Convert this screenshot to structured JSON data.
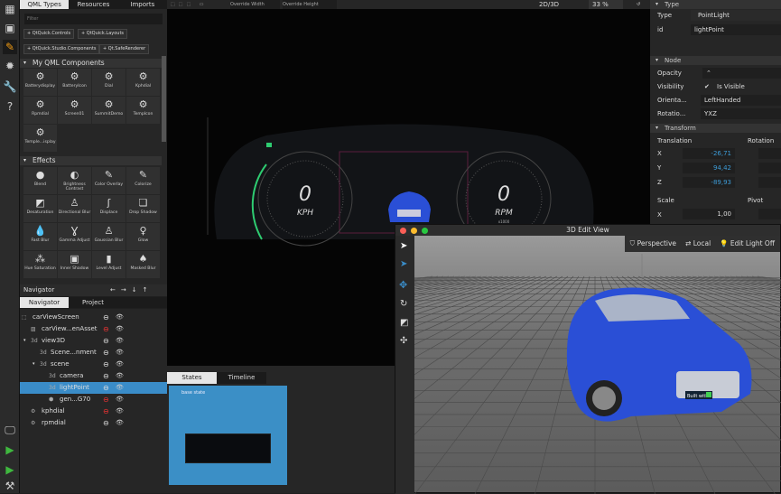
{
  "library": {
    "tabs": [
      "QML Types",
      "Resources",
      "Imports"
    ],
    "filter_placeholder": "Filter",
    "imports": [
      "QtQuick.Controls",
      "QtQuick.Layouts",
      "QtQuick.Studio.Components",
      "Qt.SafeRenderer"
    ],
    "my_components_title": "My QML Components",
    "components": [
      "Batterydisplay",
      "BatteryIcon",
      "Dial",
      "Kphdial",
      "Rpmdial",
      "Screen01",
      "SummitDemo",
      "TempIcon",
      "Temple...isplay"
    ],
    "effects_title": "Effects",
    "effects": [
      {
        "label": "Blend",
        "icon": "●"
      },
      {
        "label": "Brightness Contrast",
        "icon": "◐"
      },
      {
        "label": "Color Overlay",
        "icon": "✎"
      },
      {
        "label": "Colorize",
        "icon": "✎"
      },
      {
        "label": "Desaturation",
        "icon": "◩"
      },
      {
        "label": "Directional Blur",
        "icon": "♙"
      },
      {
        "label": "Displace",
        "icon": "ʃ"
      },
      {
        "label": "Drop Shadow",
        "icon": "❏"
      },
      {
        "label": "Fast Blur",
        "icon": "💧"
      },
      {
        "label": "Gamma Adjust",
        "icon": "Ɣ"
      },
      {
        "label": "Gaussian Blur",
        "icon": "♙"
      },
      {
        "label": "Glow",
        "icon": "♀"
      },
      {
        "label": "Hue Saturation",
        "icon": "⁂"
      },
      {
        "label": "Inner Shadow",
        "icon": "▣"
      },
      {
        "label": "Level Adjust",
        "icon": "▮"
      },
      {
        "label": "Masked Blur",
        "icon": "♠"
      }
    ]
  },
  "navigator": {
    "title": "Navigator",
    "tabs": [
      "Navigator",
      "Project"
    ],
    "items": [
      {
        "label": "carViewScreen",
        "depth": 0,
        "icon": "⬚",
        "lock": "normal"
      },
      {
        "label": "carView...enAsset",
        "depth": 1,
        "icon": "▨",
        "lock": "red"
      },
      {
        "label": "view3D",
        "depth": 1,
        "icon": "3d",
        "lock": "normal",
        "expanded": true
      },
      {
        "label": "Scene...nment",
        "depth": 2,
        "icon": "3d",
        "lock": "normal"
      },
      {
        "label": "scene",
        "depth": 2,
        "icon": "3d",
        "lock": "normal",
        "expanded": true
      },
      {
        "label": "camera",
        "depth": 3,
        "icon": "3d",
        "lock": "normal"
      },
      {
        "label": "lightPoint",
        "depth": 3,
        "icon": "3d",
        "lock": "normal",
        "selected": true
      },
      {
        "label": "gen...G70",
        "depth": 3,
        "icon": "⬢",
        "lock": "red"
      },
      {
        "label": "kphdial",
        "depth": 1,
        "icon": "⚙",
        "lock": "red"
      },
      {
        "label": "rpmdial",
        "depth": 1,
        "icon": "⚙",
        "lock": "normal"
      }
    ]
  },
  "canvas_toolbar": {
    "override_width": "Override Width",
    "override_height": "Override Height",
    "mode": "2D/3D",
    "zoom": "33 %"
  },
  "dashboard": {
    "left_value": "0",
    "left_unit": "KPH",
    "right_value": "0",
    "right_unit": "RPM",
    "right_sub": "x1000"
  },
  "states": {
    "tabs": [
      "States",
      "Timeline"
    ],
    "base_state": "base state"
  },
  "properties": {
    "type_section": "Type",
    "type_label": "Type",
    "type_value": "PointLight",
    "id_label": "id",
    "id_value": "lightPoint",
    "node_section": "Node",
    "opacity_label": "Opacity",
    "visibility_label": "Visibility",
    "visibility_value": "Is Visible",
    "orientation_label": "Orienta...",
    "orientation_value": "LeftHanded",
    "rotation_order_label": "Rotatio...",
    "rotation_order_value": "YXZ",
    "transform_section": "Transform",
    "translation_label": "Translation",
    "rotation_label": "Rotation",
    "tx": "-26,71",
    "ty": "94,42",
    "tz": "-89,93",
    "scale_label": "Scale",
    "pivot_label": "Pivot",
    "sx": "1,00",
    "axes": [
      "X",
      "Y",
      "Z"
    ]
  },
  "edit3d": {
    "title": "3D Edit View",
    "perspective": "Perspective",
    "local": "Local",
    "edit_light": "Edit Light Off",
    "badge": "Built with"
  },
  "colors": {
    "accent": "#3a8cc8",
    "number": "#3d9bd6",
    "gauge_green": "#2ecc71",
    "car_blue": "#2a4fd6"
  }
}
